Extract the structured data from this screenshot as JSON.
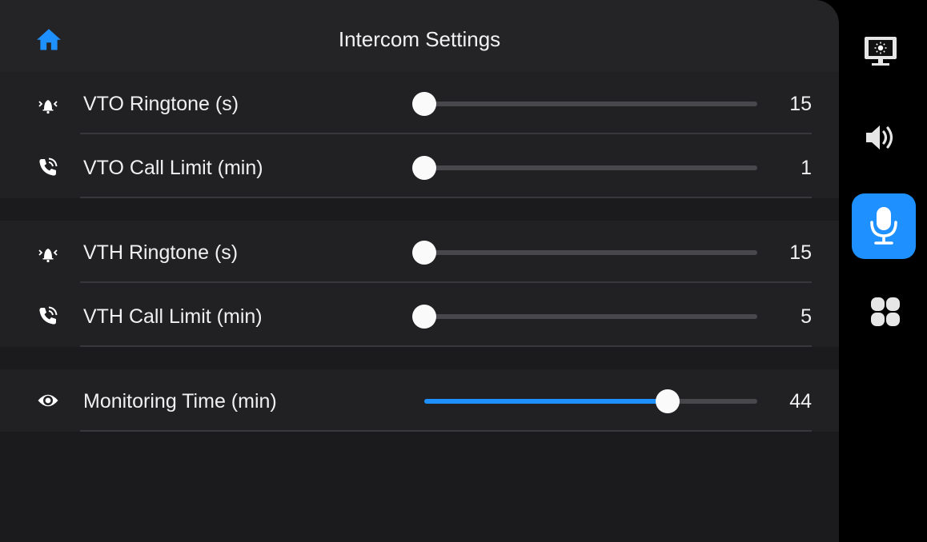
{
  "header": {
    "title": "Intercom Settings",
    "home_icon": "home-icon"
  },
  "colors": {
    "accent": "#1e90ff",
    "panel_bg": "#1b1b1e",
    "row_bg": "#212124",
    "sidebar_bg": "#000000"
  },
  "settings": [
    {
      "label": "VTO Ringtone (s)",
      "value": "15",
      "fraction": 0.0,
      "icon": "ring-bell-icon"
    },
    {
      "label": "VTO Call Limit (min)",
      "value": "1",
      "fraction": 0.0,
      "icon": "phone-call-icon"
    },
    {
      "label": "VTH Ringtone (s)",
      "value": "15",
      "fraction": 0.0,
      "icon": "ring-bell-icon"
    },
    {
      "label": "VTH Call Limit (min)",
      "value": "5",
      "fraction": 0.0,
      "icon": "phone-call-icon"
    },
    {
      "label": "Monitoring Time (min)",
      "value": "44",
      "fraction": 0.73,
      "icon": "eye-icon"
    }
  ],
  "sidebar": {
    "items": [
      {
        "name": "display",
        "icon": "display-brightness-icon",
        "active": false
      },
      {
        "name": "sound",
        "icon": "speaker-icon",
        "active": false
      },
      {
        "name": "intercom",
        "icon": "microphone-icon",
        "active": true
      },
      {
        "name": "apps",
        "icon": "apps-grid-icon",
        "active": false
      }
    ]
  }
}
